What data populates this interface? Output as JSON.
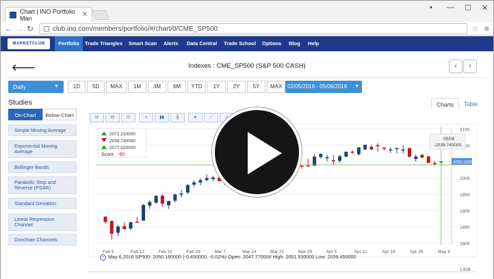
{
  "browser": {
    "tab_title": "Chart | INO Portfolio Man",
    "url": "club.ino.com/members/portfolio/#/chart/0/CME_SP500"
  },
  "nav": {
    "logo": "MARKETCLUB",
    "items": [
      "Portfolio",
      "Trade Triangles",
      "Smart Scan",
      "Alerts",
      "Data Central",
      "Trade School",
      "Options",
      "Blog",
      "Help"
    ]
  },
  "page": {
    "title": "Indexes : CME_SP500 (S&P 500 CASH)",
    "interval": "Daily",
    "ranges": [
      "1D",
      "5D",
      "MAX",
      "1M",
      "3M",
      "6M",
      "YTD",
      "1Y",
      "2Y",
      "5Y",
      "MAX"
    ],
    "date_range": "02/05/2016 - 05/06/2016"
  },
  "studies": {
    "heading": "Studies",
    "seg_on": "On-Chart",
    "seg_off": "Below-Chart",
    "items": [
      "Simple Moving Average",
      "Exponential Moving Average",
      "Bollinger Bands",
      "Parabolic Stop and Reverse (PSAR)",
      "Standard Deviation",
      "Linear Regression Channel",
      "Donchian Channels"
    ]
  },
  "view_tabs": {
    "charts": "Charts",
    "table": "Table"
  },
  "toolbar": [
    "M",
    "W",
    "D"
  ],
  "legend": {
    "v1": "2072.210000",
    "v2": "2039.740000",
    "v3": "2077.520000",
    "score_label": "Score",
    "score_value": "-60"
  },
  "tooltip": {
    "date": "05/06",
    "value": "-2039.740000"
  },
  "price_tag": "2050.1800",
  "bottom_axis_tag": "1.81B",
  "readout": "May 6,2016 SP500: 2050.180000 (-0.450000, -0.02%) Open: 2047.770000 High: 2051.530000 Low: 2039.450000",
  "colors": {
    "nav": "#1f3a8a",
    "active": "#2f72c9",
    "up": "#1f3f7a",
    "down": "#c0161b",
    "ref": "#6cc04a"
  },
  "chart_data": {
    "type": "candlestick",
    "x_ticks": [
      "Feb 5",
      "Feb 12",
      "Feb 22",
      "Feb 29",
      "Mar 7",
      "Mar 14",
      "Mar 21",
      "Mar 29",
      "Apr 5",
      "Apr 12",
      "Apr 19",
      "Apr 26",
      "May 3"
    ],
    "y_ticks": [
      2150,
      2100,
      2050,
      2000,
      1950,
      1900,
      1850,
      1800
    ],
    "ylim": [
      1795,
      2155
    ],
    "candles": [
      [
        1881,
        1883,
        1860,
        1865
      ],
      [
        1868,
        1870,
        1810,
        1829
      ],
      [
        1832,
        1856,
        1822,
        1851
      ],
      [
        1852,
        1864,
        1841,
        1843
      ],
      [
        1845,
        1866,
        1839,
        1864
      ],
      [
        1866,
        1880,
        1862,
        1864
      ],
      [
        1869,
        1920,
        1869,
        1917
      ],
      [
        1915,
        1932,
        1905,
        1926
      ],
      [
        1924,
        1947,
        1920,
        1945
      ],
      [
        1945,
        1950,
        1912,
        1921
      ],
      [
        1916,
        1930,
        1905,
        1929
      ],
      [
        1930,
        1952,
        1925,
        1949
      ],
      [
        1950,
        1963,
        1940,
        1952
      ],
      [
        1955,
        1981,
        1950,
        1978
      ],
      [
        1979,
        1992,
        1972,
        1986
      ],
      [
        1986,
        1999,
        1977,
        1993
      ],
      [
        1993,
        2011,
        1990,
        1999
      ],
      [
        1996,
        2006,
        1990,
        2001
      ],
      [
        2001,
        2009,
        1989,
        1990
      ],
      [
        1987,
        2001,
        1979,
        1979
      ],
      [
        1981,
        1993,
        1970,
        1989
      ],
      [
        1988,
        1993,
        1970,
        1986
      ],
      [
        1988,
        2023,
        1987,
        2022
      ],
      [
        2021,
        2024,
        2012,
        2019
      ],
      [
        2019,
        2022,
        2011,
        2016
      ],
      [
        2017,
        2042,
        2016,
        2040
      ],
      [
        2041,
        2052,
        2036,
        2049
      ],
      [
        2047,
        2052,
        2042,
        2051
      ],
      [
        2051,
        2057,
        2045,
        2049
      ],
      [
        2048,
        2053,
        2041,
        2051
      ],
      [
        2049,
        2056,
        2037,
        2037
      ],
      [
        2037,
        2041,
        2027,
        2036
      ],
      [
        2038,
        2058,
        2034,
        2036
      ],
      [
        2037,
        2072,
        2036,
        2065
      ],
      [
        2064,
        2075,
        2059,
        2073
      ],
      [
        2060,
        2071,
        2051,
        2063
      ],
      [
        2054,
        2070,
        2039,
        2053
      ],
      [
        2052,
        2070,
        2046,
        2066
      ],
      [
        2065,
        2080,
        2063,
        2080
      ],
      [
        2080,
        2084,
        2072,
        2079
      ],
      [
        2072,
        2094,
        2068,
        2093
      ],
      [
        2087,
        2101,
        2085,
        2101
      ],
      [
        2095,
        2101,
        2085,
        2087
      ],
      [
        2100,
        2106,
        2080,
        2099
      ],
      [
        2092,
        2095,
        2084,
        2091
      ],
      [
        2085,
        2093,
        2076,
        2087
      ],
      [
        2090,
        2093,
        2075,
        2091
      ],
      [
        2086,
        2099,
        2075,
        2087
      ],
      [
        2091,
        2093,
        2062,
        2065
      ],
      [
        2058,
        2071,
        2050,
        2065
      ],
      [
        2070,
        2074,
        2060,
        2062
      ],
      [
        2066,
        2065,
        2045,
        2046
      ],
      [
        2045,
        2052,
        2037,
        2044
      ],
      [
        2047,
        2052,
        2039,
        2050
      ]
    ]
  }
}
